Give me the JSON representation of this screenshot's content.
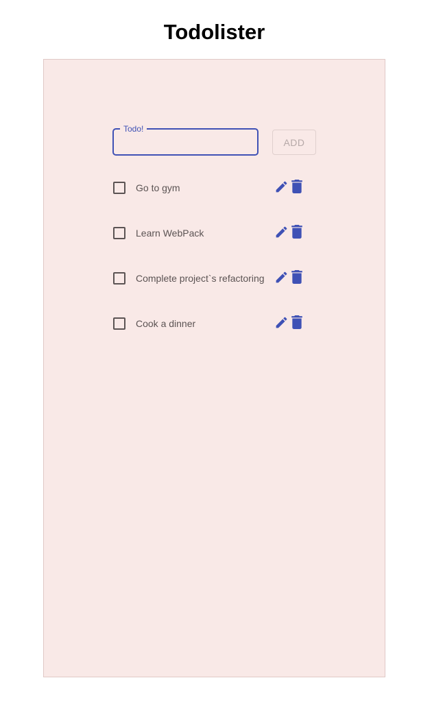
{
  "app": {
    "title": "Todolister"
  },
  "form": {
    "field_label": "Todo!",
    "field_value": "",
    "add_label": "ADD"
  },
  "todos": [
    {
      "text": "Go to gym",
      "checked": false
    },
    {
      "text": "Learn WebPack",
      "checked": false
    },
    {
      "text": "Complete project`s refactoring",
      "checked": false
    },
    {
      "text": "Cook a dinner",
      "checked": false
    }
  ],
  "icons": {
    "edit": "pencil-icon",
    "delete": "trash-icon"
  },
  "colors": {
    "accent": "#3f51b5",
    "panel_background": "#f9e9e7",
    "text": "#5b5353",
    "disabled": "#b6a9a8"
  }
}
